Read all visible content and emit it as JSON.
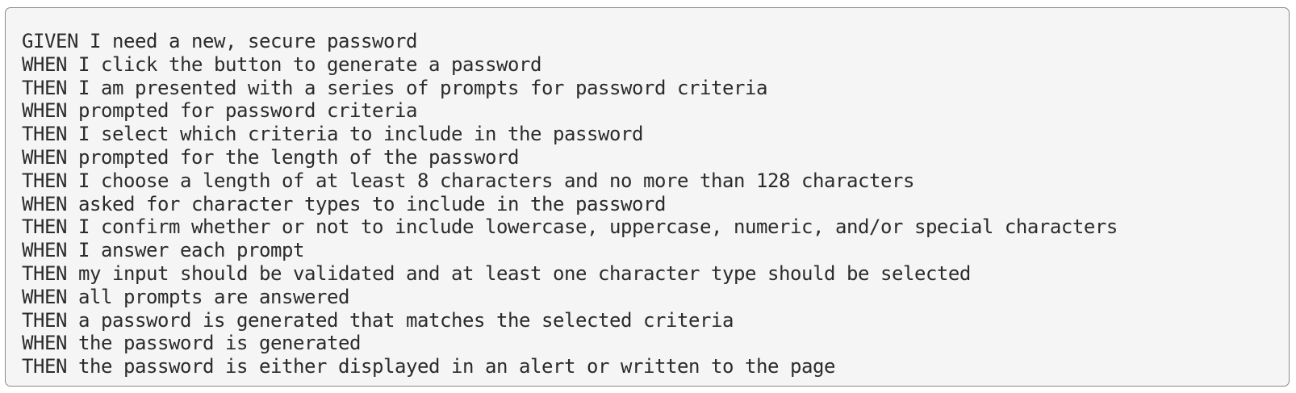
{
  "code_block": {
    "lines": [
      "GIVEN I need a new, secure password",
      "WHEN I click the button to generate a password",
      "THEN I am presented with a series of prompts for password criteria",
      "WHEN prompted for password criteria",
      "THEN I select which criteria to include in the password",
      "WHEN prompted for the length of the password",
      "THEN I choose a length of at least 8 characters and no more than 128 characters",
      "WHEN asked for character types to include in the password",
      "THEN I confirm whether or not to include lowercase, uppercase, numeric, and/or special characters",
      "WHEN I answer each prompt",
      "THEN my input should be validated and at least one character type should be selected",
      "WHEN all prompts are answered",
      "THEN a password is generated that matches the selected criteria",
      "WHEN the password is generated",
      "THEN the password is either displayed in an alert or written to the page"
    ]
  }
}
